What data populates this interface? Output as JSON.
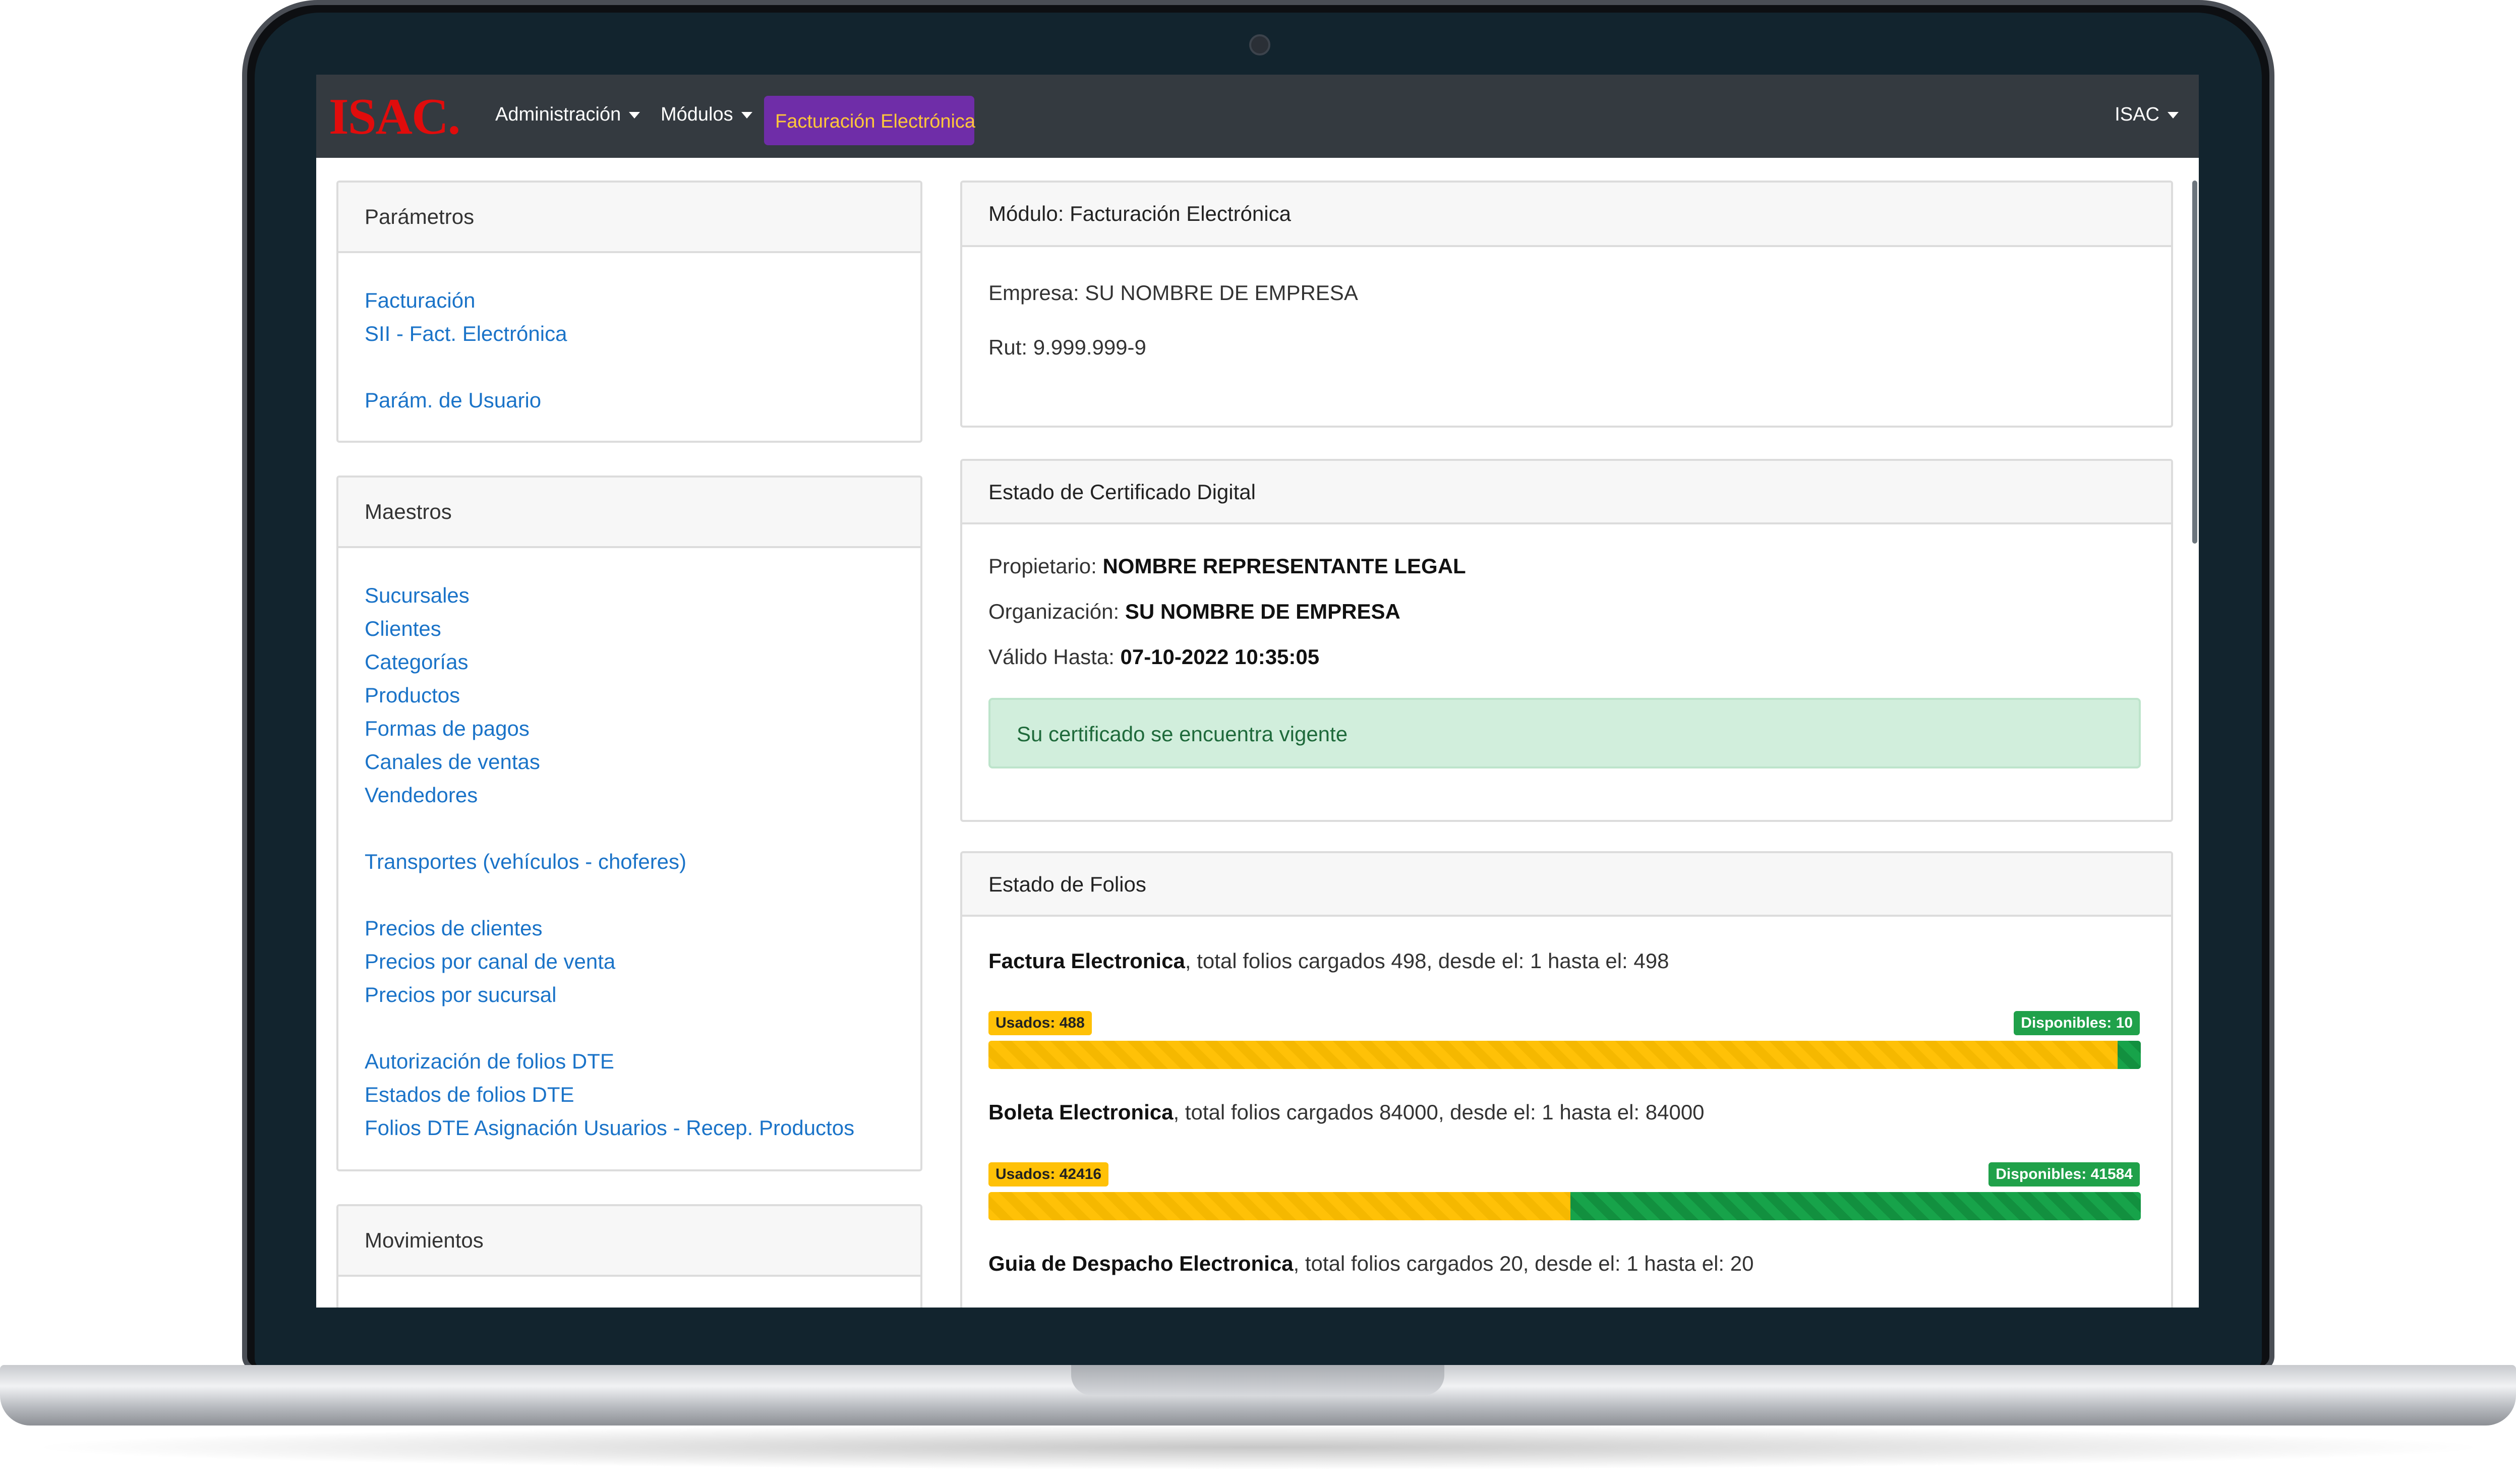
{
  "navbar": {
    "brand": "ISAC.",
    "items": [
      {
        "label": "Administración"
      },
      {
        "label": "Módulos"
      }
    ],
    "active_item": "Facturación Electrónica",
    "user": "ISAC"
  },
  "sidebar": {
    "parametros": {
      "title": "Parámetros",
      "links": [
        "Facturación",
        "SII - Fact. Electrónica",
        "Parám. de Usuario"
      ]
    },
    "maestros": {
      "title": "Maestros",
      "links": [
        "Sucursales",
        "Clientes",
        "Categorías",
        "Productos",
        "Formas de pagos",
        "Canales de ventas",
        "Vendedores",
        "Transportes (vehículos - choferes)",
        "Precios de clientes",
        "Precios por canal de venta",
        "Precios por sucursal",
        "Autorización de folios DTE",
        "Estados de folios DTE",
        "Folios DTE Asignación Usuarios - Recep. Productos"
      ]
    },
    "movimientos": {
      "title": "Movimientos"
    }
  },
  "modulo": {
    "title": "Módulo: Facturación Electrónica",
    "empresa": "Empresa: SU NOMBRE DE EMPRESA",
    "rut": "Rut: 9.999.999-9"
  },
  "certificado": {
    "title": "Estado de Certificado Digital",
    "propietario_label": "Propietario: ",
    "propietario": "NOMBRE REPRESENTANTE LEGAL",
    "organizacion_label": "Organización: ",
    "organizacion": "SU NOMBRE DE EMPRESA",
    "valido_label": "Válido Hasta: ",
    "valido": "07-10-2022 10:35:05",
    "alert": "Su certificado se encuentra vigente"
  },
  "folios": {
    "title": "Estado de Folios",
    "items": [
      {
        "name": "Factura Electronica",
        "detail": ", total folios cargados 498, desde el: 1 hasta el: 498",
        "used_label": "Usados: 488",
        "free_label": "Disponibles: 10",
        "used": 488,
        "total": 498
      },
      {
        "name": "Boleta Electronica",
        "detail": ", total folios cargados 84000, desde el: 1 hasta el: 84000",
        "used_label": "Usados: 42416",
        "free_label": "Disponibles: 41584",
        "used": 42416,
        "total": 84000
      },
      {
        "name": "Guia de Despacho Electronica",
        "detail": ", total folios cargados 20, desde el: 1 hasta el: 20"
      }
    ]
  },
  "colors": {
    "navbar": "#343a40",
    "brand": "#e10c0c",
    "active": "#6f2da8",
    "active_text": "#ffc73a",
    "link": "#1a73c8",
    "used": "#ffc107",
    "free": "#20a14a"
  }
}
